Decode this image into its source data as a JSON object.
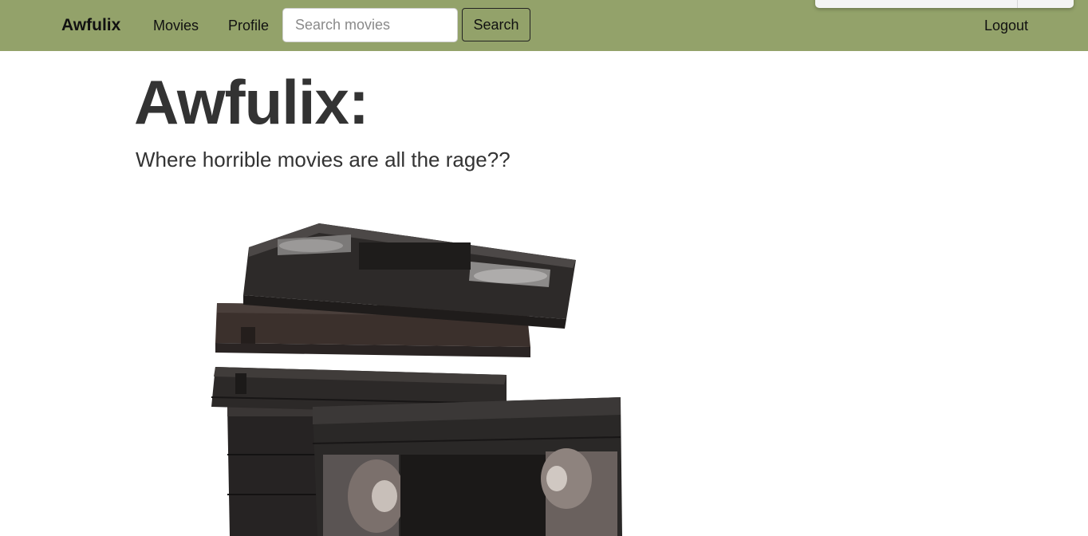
{
  "navbar": {
    "brand": "Awfulix",
    "links": [
      {
        "label": "Movies"
      },
      {
        "label": "Profile"
      }
    ],
    "search": {
      "placeholder": "Search movies",
      "value": "",
      "button_label": "Search"
    },
    "logout_label": "Logout",
    "background": "#93a26a"
  },
  "hero": {
    "title": "Awfulix:",
    "subtitle": "Where horrible movies are all the rage??",
    "image_icon": "vhs-tapes-stack"
  }
}
